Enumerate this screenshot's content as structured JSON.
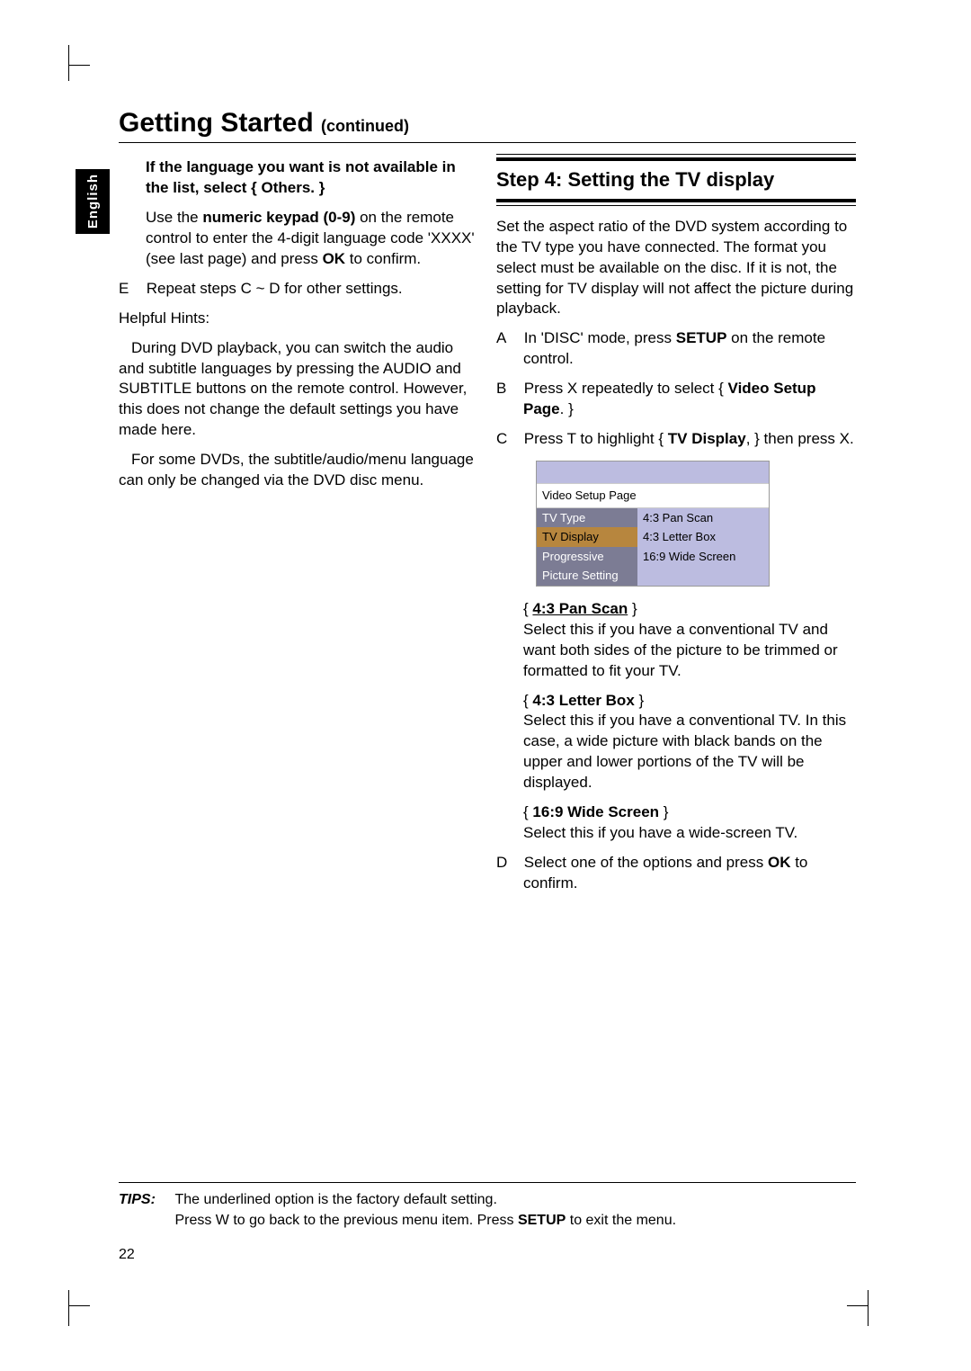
{
  "language_tab": "English",
  "page_title_main": "Getting Started",
  "page_title_cont": "(continued)",
  "left": {
    "if_lang_heading": "If the language you want is not available in the list, select { Others. }",
    "use_keypad_pre": "Use the ",
    "use_keypad_bold": "numeric keypad (0-9)",
    "use_keypad_mid": " on the remote control to enter the 4-digit language code 'XXXX' (see last page) and press ",
    "use_keypad_ok": "OK",
    "use_keypad_post": " to confirm.",
    "step_e_letter": "E",
    "step_e_pre": "Repeat steps ",
    "step_e_range": "C ~ D",
    "step_e_post": " for other settings.",
    "hints_label": "Helpful Hints:",
    "hints_p1": "During DVD playback, you can switch the audio and subtitle languages by pressing the AUDIO and SUBTITLE buttons on the remote control.  However, this does not change the default settings you have made here.",
    "hints_p2": "For some DVDs, the subtitle/audio/menu language can only be changed via the DVD disc menu."
  },
  "right": {
    "step_heading": "Step 4:  Setting the TV display",
    "intro": "Set the aspect ratio of the DVD system according to the TV type you have connected. The format you select must be available on the disc.  If it is not, the setting for TV display will not affect the picture during playback.",
    "a_letter": "A",
    "a_pre": "In 'DISC' mode, press ",
    "a_bold": "SETUP",
    "a_post": " on the remote control.",
    "b_letter": "B",
    "b_pre": "Press  X repeatedly to select { ",
    "b_bold": "Video Setup Page",
    "b_post": ". }",
    "c_letter": "C",
    "c_pre": "Press  T  to highlight { ",
    "c_bold": "TV Display",
    "c_post": ", } then press  X.",
    "menu": {
      "title": "Video Setup Page",
      "left_items": [
        "TV Type",
        "TV Display",
        "Progressive",
        "Picture Setting"
      ],
      "right_items": [
        "4:3 Pan Scan",
        "4:3 Letter Box",
        "16:9 Wide Screen"
      ]
    },
    "opt1_label": "4:3 Pan Scan",
    "opt1_text": "Select this if you have a conventional TV and want both sides of the picture to be trimmed or formatted to fit your TV.",
    "opt2_label": "4:3 Letter Box",
    "opt2_text": "Select this if you have a conventional TV.  In this case, a wide picture with black bands on the upper and lower portions of the TV will be displayed.",
    "opt3_label": "16:9 Wide Screen",
    "opt3_text": "Select this if you have a wide-screen TV.",
    "d_letter": "D",
    "d_pre": "Select one of the options and press ",
    "d_bold": "OK",
    "d_post": " to confirm."
  },
  "tips": {
    "label": "TIPS:",
    "line1": "The underlined option is the factory default setting.",
    "line2_pre": "Press  W to go back to the previous menu item.  Press ",
    "line2_bold": "SETUP",
    "line2_post": " to exit the menu."
  },
  "page_number": "22"
}
